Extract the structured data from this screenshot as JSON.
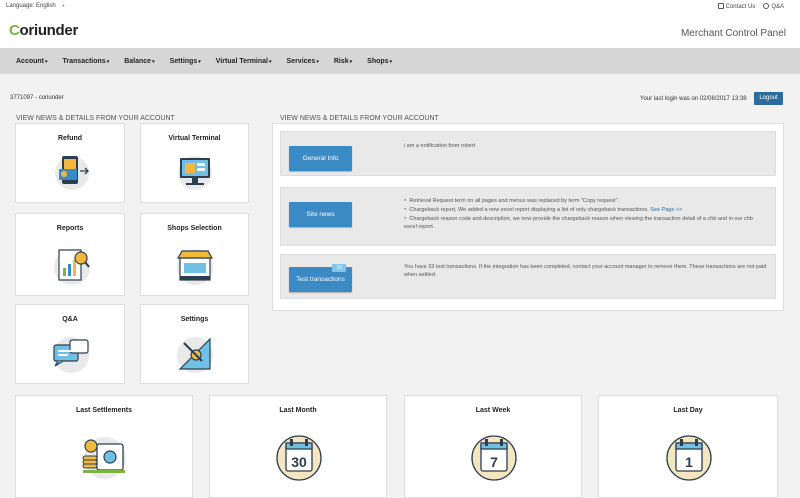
{
  "header": {
    "language_label": "Language: English",
    "language_caret": "▼",
    "contact_label": "Contact Us",
    "qa_label": "Q&A",
    "logo_c": "C",
    "logo_rest": "oriunder",
    "panel_title": "Merchant Control Panel"
  },
  "nav": {
    "items": [
      {
        "label": "Account"
      },
      {
        "label": "Transactions"
      },
      {
        "label": "Balance"
      },
      {
        "label": "Settings"
      },
      {
        "label": "Virtual Terminal"
      },
      {
        "label": "Services"
      },
      {
        "label": "Risk"
      },
      {
        "label": "Shops"
      }
    ],
    "caret": "▾"
  },
  "account": {
    "id_label": "3771097 - coriunder",
    "last_login": "Your last login was on 02/08/2017 13:38",
    "logout_label": "Logout"
  },
  "left_section_title": "VIEW NEWS & DETAILS FROM YOUR ACCOUNT",
  "right_section_title": "VIEW NEWS & DETAILS FROM YOUR ACCOUNT",
  "tiles": [
    {
      "label": "Refund",
      "icon": "refund-icon"
    },
    {
      "label": "Virtual Terminal",
      "icon": "virtual-terminal-icon"
    },
    {
      "label": "Reports",
      "icon": "reports-icon"
    },
    {
      "label": "Shops Selection",
      "icon": "shop-icon"
    },
    {
      "label": "Q&A",
      "icon": "qa-icon"
    },
    {
      "label": "Settings",
      "icon": "settings-icon"
    }
  ],
  "news": {
    "general": {
      "button": "General Info",
      "text": "i am a notification from robert"
    },
    "site": {
      "button": "Site news",
      "items": [
        "Retrieval Request term on all pages and menus was replaced by term \"Copy request\".",
        "Chargeback report, We added a new excel report displaying a list of only chargeback transactions.",
        "Chargeback reason code and description, we now provide the chargeback reason when viewing the transaction detail of a chb and in our chb excel report."
      ],
      "see_page": "See Page >>"
    },
    "test": {
      "button": "Test transactions",
      "badge": "33",
      "text": "You have 33 test transactions. If the integration has been completed, contact your account manager to remove them. These transactions are not paid when settled."
    }
  },
  "bottom_tiles": [
    {
      "label": "Last Settlements",
      "icon": "safe-coins-icon"
    },
    {
      "label": "Last Month",
      "icon": "calendar-icon",
      "number": "30"
    },
    {
      "label": "Last Week",
      "icon": "calendar-icon",
      "number": "7"
    },
    {
      "label": "Last Day",
      "icon": "calendar-icon",
      "number": "1"
    }
  ],
  "colors": {
    "accent": "#2c6c9c",
    "button_blue": "#3b8ac4",
    "logo_green": "#7cb342",
    "nav_bg": "#d6d6d6"
  }
}
